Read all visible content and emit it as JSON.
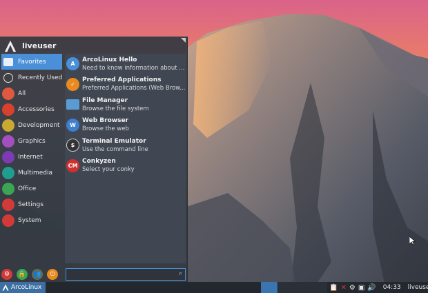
{
  "menu": {
    "username": "liveuser",
    "categories": [
      {
        "label": "Favorites",
        "icon": "star-icon",
        "color": "#4a90d9"
      },
      {
        "label": "Recently Used",
        "icon": "clock-icon",
        "color": "#e8e8e8"
      },
      {
        "label": "All",
        "icon": "grid-icon",
        "color": "#e0583f"
      },
      {
        "label": "Accessories",
        "icon": "tools-icon",
        "color": "#d9412e"
      },
      {
        "label": "Development",
        "icon": "code-icon",
        "color": "#c9a92f"
      },
      {
        "label": "Graphics",
        "icon": "palette-icon",
        "color": "#a44fbf"
      },
      {
        "label": "Internet",
        "icon": "globe-icon",
        "color": "#7c3bb5"
      },
      {
        "label": "Multimedia",
        "icon": "music-icon",
        "color": "#1f9e8f"
      },
      {
        "label": "Office",
        "icon": "document-icon",
        "color": "#3aa552"
      },
      {
        "label": "Settings",
        "icon": "gear-icon",
        "color": "#d23a3a"
      },
      {
        "label": "System",
        "icon": "system-icon",
        "color": "#d23a3a"
      }
    ],
    "apps": [
      {
        "name": "ArcoLinux Hello",
        "desc": "Need to know information about ...",
        "icon": "arcolinux-icon",
        "color": "#4a90d9",
        "glyph": "A"
      },
      {
        "name": "Preferred Applications",
        "desc": "Preferred Applications (Web Brow...",
        "icon": "preferred-apps-icon",
        "color": "#e88a1f",
        "glyph": "✓"
      },
      {
        "name": "File Manager",
        "desc": "Browse the file system",
        "icon": "folder-icon",
        "color": "#5b9bd5",
        "glyph": ""
      },
      {
        "name": "Web Browser",
        "desc": "Browse the web",
        "icon": "web-browser-icon",
        "color": "#3e7fcf",
        "glyph": "W"
      },
      {
        "name": "Terminal Emulator",
        "desc": "Use the command line",
        "icon": "terminal-icon",
        "color": "#333333",
        "glyph": "$"
      },
      {
        "name": "Conkyzen",
        "desc": "Select your conky",
        "icon": "conky-icon",
        "color": "#d2302f",
        "glyph": "CM"
      }
    ],
    "actions": [
      {
        "icon": "settings-action-icon",
        "color": "#d23a3a",
        "glyph": "⚙"
      },
      {
        "icon": "lock-icon",
        "color": "#3aa552",
        "glyph": "🔒"
      },
      {
        "icon": "switch-user-icon",
        "color": "#5a6e5a",
        "glyph": "👥"
      },
      {
        "icon": "logout-icon",
        "color": "#e88a1f",
        "glyph": "⏻"
      }
    ],
    "search": {
      "placeholder": "",
      "value": ""
    }
  },
  "taskbar": {
    "start_label": "ArcoLinux",
    "clock": "04:33",
    "user": "liveuser",
    "tray_icons": [
      "clipboard-icon",
      "network-icon",
      "settings-tray-icon",
      "display-icon",
      "volume-icon"
    ]
  },
  "colors": {
    "accent": "#4a90d9",
    "menu_bg": "#343942",
    "taskbar_bg": "#23272e"
  }
}
